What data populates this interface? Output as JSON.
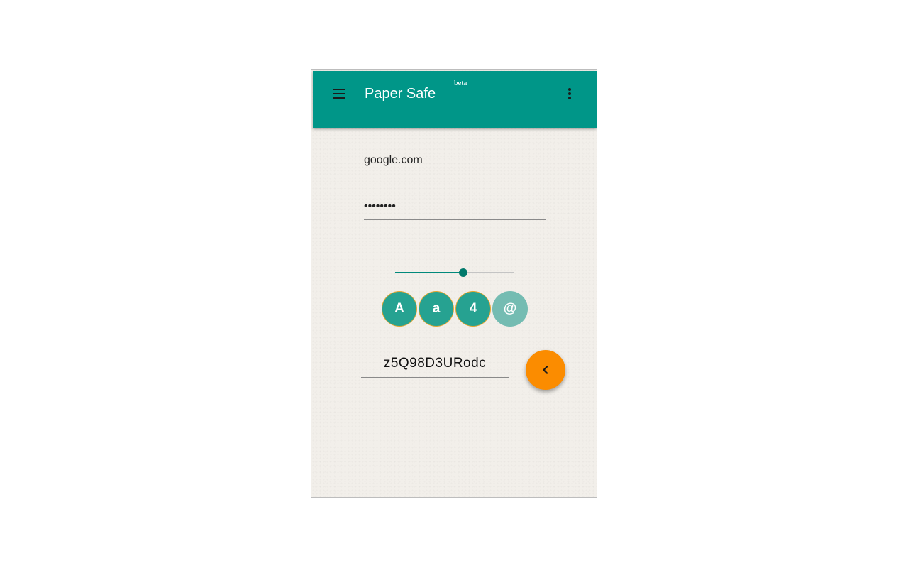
{
  "app_bar": {
    "title": "Paper Safe",
    "badge": "beta",
    "menu_icon": "menu-icon",
    "overflow_icon": "more-vert-icon",
    "color": "#009688"
  },
  "form": {
    "domain_value": "google.com",
    "password_value": "••••••••"
  },
  "length_slider": {
    "level_fraction": 0.57
  },
  "char_toggles": [
    {
      "label": "A",
      "active": true
    },
    {
      "label": "a",
      "active": true
    },
    {
      "label": "4",
      "active": true
    },
    {
      "label": "@",
      "active": false
    }
  ],
  "result": {
    "generated_password": "z5Q98D3URodc"
  },
  "fab": {
    "icon": "chevron-left-icon",
    "color": "#fb8c00"
  },
  "colors": {
    "toggle_on": "#26a291",
    "toggle_off": "#74bcb2",
    "toggle_ring": "#e0a531",
    "slider_fill": "#00897b"
  }
}
